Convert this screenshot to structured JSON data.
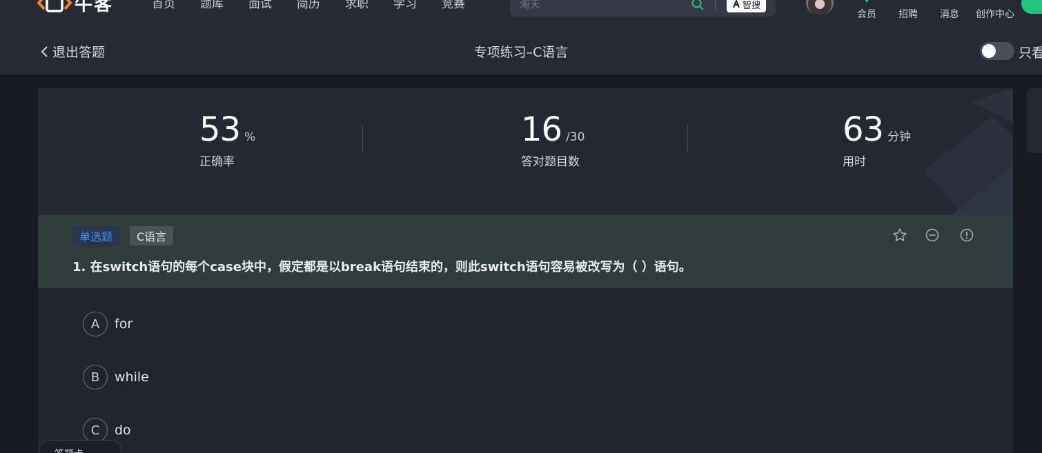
{
  "nav": {
    "logo_text": "牛客",
    "links": [
      "首页",
      "题库",
      "面试",
      "简历",
      "求职",
      "学习",
      "竞赛"
    ],
    "search_placeholder": "淘天",
    "smart_search_label": "智搜",
    "actions": [
      "会员",
      "招聘",
      "消息",
      "创作中心"
    ]
  },
  "subheader": {
    "back_label": "退出答题",
    "title": "专项练习–C语言",
    "toggle_label": "只看"
  },
  "stats": {
    "accuracy_value": "53",
    "accuracy_unit": "%",
    "accuracy_label": "正确率",
    "correct_value": "16",
    "correct_total": "/30",
    "correct_label": "答对题目数",
    "time_value": "63",
    "time_unit": "分钟",
    "time_label": "用时"
  },
  "question": {
    "type_tag": "单选题",
    "topic_tag": "C语言",
    "text": "1. 在switch语句的每个case块中，假定都是以break语句结束的，则此switch语句容易被改写为（ ）语句。",
    "options": [
      {
        "letter": "A",
        "text": "for"
      },
      {
        "letter": "B",
        "text": "while"
      },
      {
        "letter": "C",
        "text": "do"
      }
    ]
  },
  "sheet_button_label": "答题卡",
  "colors": {
    "accent_green": "#1fc47e",
    "tag_blue": "#3b8cf5",
    "logo_orange": "#f5821f"
  }
}
